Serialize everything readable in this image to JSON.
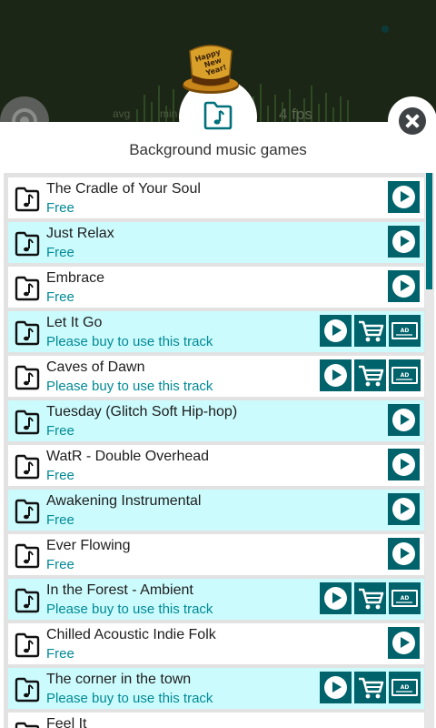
{
  "header": {
    "title": "Background music games",
    "hat_text": [
      "Happy",
      "New",
      "Year!"
    ],
    "fps_ghost": "4 fps",
    "ghost_avg": "avg",
    "ghost_min": "min"
  },
  "colors": {
    "accent": "#00636b",
    "row_highlight": "#ccfbfd",
    "status_text": "#008a96",
    "top_bg": "#1c2616"
  },
  "tracks": [
    {
      "name": "The Cradle of Your Soul",
      "status": "Free",
      "buyable": false
    },
    {
      "name": "Just Relax",
      "status": "Free",
      "buyable": false
    },
    {
      "name": "Embrace",
      "status": "Free",
      "buyable": false
    },
    {
      "name": "Let It Go",
      "status": "Please buy to use this track",
      "buyable": true
    },
    {
      "name": "Caves of Dawn",
      "status": "Please buy to use this track",
      "buyable": true
    },
    {
      "name": "Tuesday (Glitch Soft Hip-hop)",
      "status": "Free",
      "buyable": false
    },
    {
      "name": "WatR - Double Overhead",
      "status": "Free",
      "buyable": false
    },
    {
      "name": "Awakening Instrumental",
      "status": "Free",
      "buyable": false
    },
    {
      "name": "Ever Flowing",
      "status": "Free",
      "buyable": false
    },
    {
      "name": "In the Forest - Ambient",
      "status": "Please buy to use this track",
      "buyable": true
    },
    {
      "name": "Chilled Acoustic Indie Folk",
      "status": "Free",
      "buyable": false
    },
    {
      "name": "The corner in the town",
      "status": "Please buy to use this track",
      "buyable": true
    },
    {
      "name": "Feel It",
      "status": "",
      "buyable": false
    }
  ],
  "icons": {
    "row_icon": "music-folder-icon",
    "play": "play-icon",
    "cart": "cart-icon",
    "ad": "ad-icon",
    "close": "close-icon",
    "settings": "settings-icon"
  },
  "ad_label": "AD"
}
